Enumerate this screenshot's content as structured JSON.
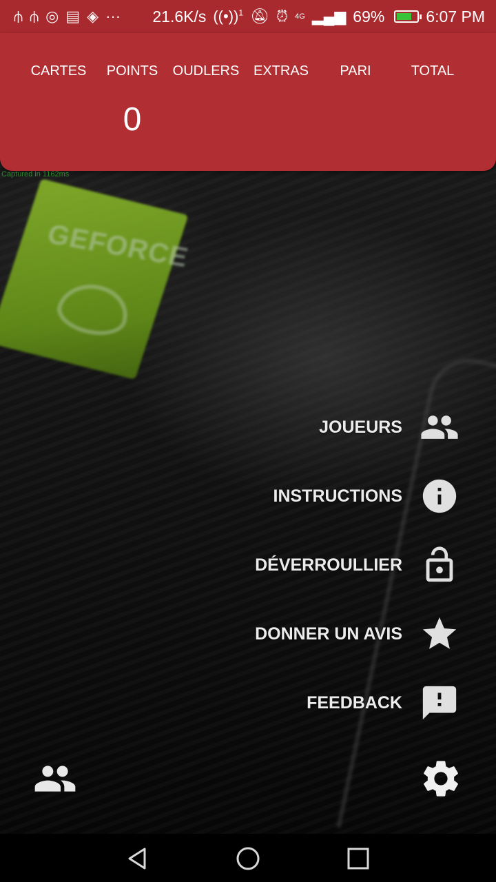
{
  "status_bar": {
    "left_icons": [
      "usb-icon",
      "usb-icon",
      "whatsapp-icon",
      "calendar-icon",
      "maps-icon",
      "more-icon"
    ],
    "network_speed": "21.6K/s",
    "hotspot_count": "1",
    "network_type": "4G",
    "battery_percent": "69%",
    "time": "6:07 PM",
    "battery_color": "#39c23a"
  },
  "score_header": {
    "columns": [
      "CARTES",
      "POINTS",
      "OUDLERS",
      "EXTRAS",
      "PARI",
      "TOTAL"
    ],
    "points_value": "0",
    "background_color": "#b12f33"
  },
  "debug": {
    "captured_text": "Captured in 1162ms"
  },
  "menu": {
    "items": [
      {
        "label": "JOUEURS",
        "icon": "players-icon"
      },
      {
        "label": "INSTRUCTIONS",
        "icon": "info-icon"
      },
      {
        "label": "DÉVERROULLIER",
        "icon": "unlock-icon"
      },
      {
        "label": "DONNER UN AVIS",
        "icon": "star-icon"
      },
      {
        "label": "FEEDBACK",
        "icon": "feedback-icon"
      }
    ]
  },
  "bottom_bar": {
    "left_icon": "players-icon",
    "right_icon": "settings-icon"
  },
  "background": {
    "sticker_text": "GEFORCE"
  },
  "nav_bar": {
    "buttons": [
      "back-icon",
      "home-icon",
      "recents-icon"
    ]
  }
}
